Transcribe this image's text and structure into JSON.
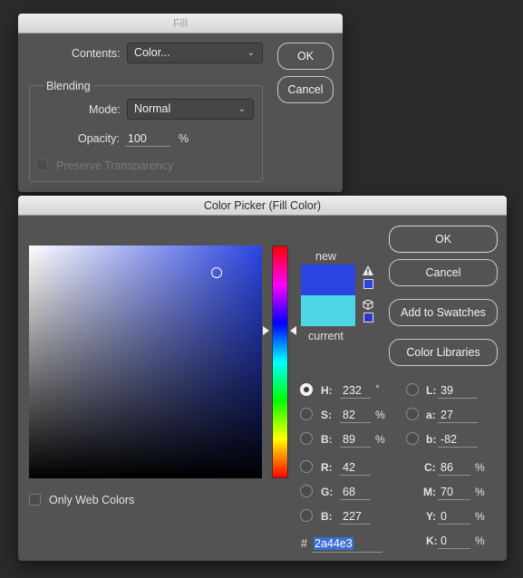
{
  "fill_dialog": {
    "title": "Fill",
    "contents_label": "Contents:",
    "contents_value": "Color...",
    "ok_label": "OK",
    "cancel_label": "Cancel",
    "blending_legend": "Blending",
    "mode_label": "Mode:",
    "mode_value": "Normal",
    "opacity_label": "Opacity:",
    "opacity_value": "100",
    "opacity_unit": "%",
    "preserve_label": "Preserve Transparency"
  },
  "color_picker": {
    "title": "Color Picker (Fill Color)",
    "new_label": "new",
    "current_label": "current",
    "new_color": "#2a44e3",
    "current_color": "#4fd6e6",
    "buttons": {
      "ok": "OK",
      "cancel": "Cancel",
      "add_to_swatches": "Add to Swatches",
      "color_libraries": "Color Libraries"
    },
    "only_web_colors": "Only Web Colors",
    "hsb": {
      "h": {
        "label": "H:",
        "value": "232",
        "unit": "°"
      },
      "s": {
        "label": "S:",
        "value": "82",
        "unit": "%"
      },
      "b": {
        "label": "B:",
        "value": "89",
        "unit": "%"
      }
    },
    "rgb": {
      "r": {
        "label": "R:",
        "value": "42"
      },
      "g": {
        "label": "G:",
        "value": "68"
      },
      "b": {
        "label": "B:",
        "value": "227"
      }
    },
    "lab": {
      "l": {
        "label": "L:",
        "value": "39"
      },
      "a": {
        "label": "a:",
        "value": "27"
      },
      "b": {
        "label": "b:",
        "value": "-82"
      }
    },
    "cmyk": {
      "c": {
        "label": "C:",
        "value": "86",
        "unit": "%"
      },
      "m": {
        "label": "M:",
        "value": "70",
        "unit": "%"
      },
      "y": {
        "label": "Y:",
        "value": "0",
        "unit": "%"
      },
      "k": {
        "label": "K:",
        "value": "0",
        "unit": "%"
      }
    },
    "hex_prefix": "#",
    "hex_value": "2a44e3",
    "selected_mode": "H"
  }
}
